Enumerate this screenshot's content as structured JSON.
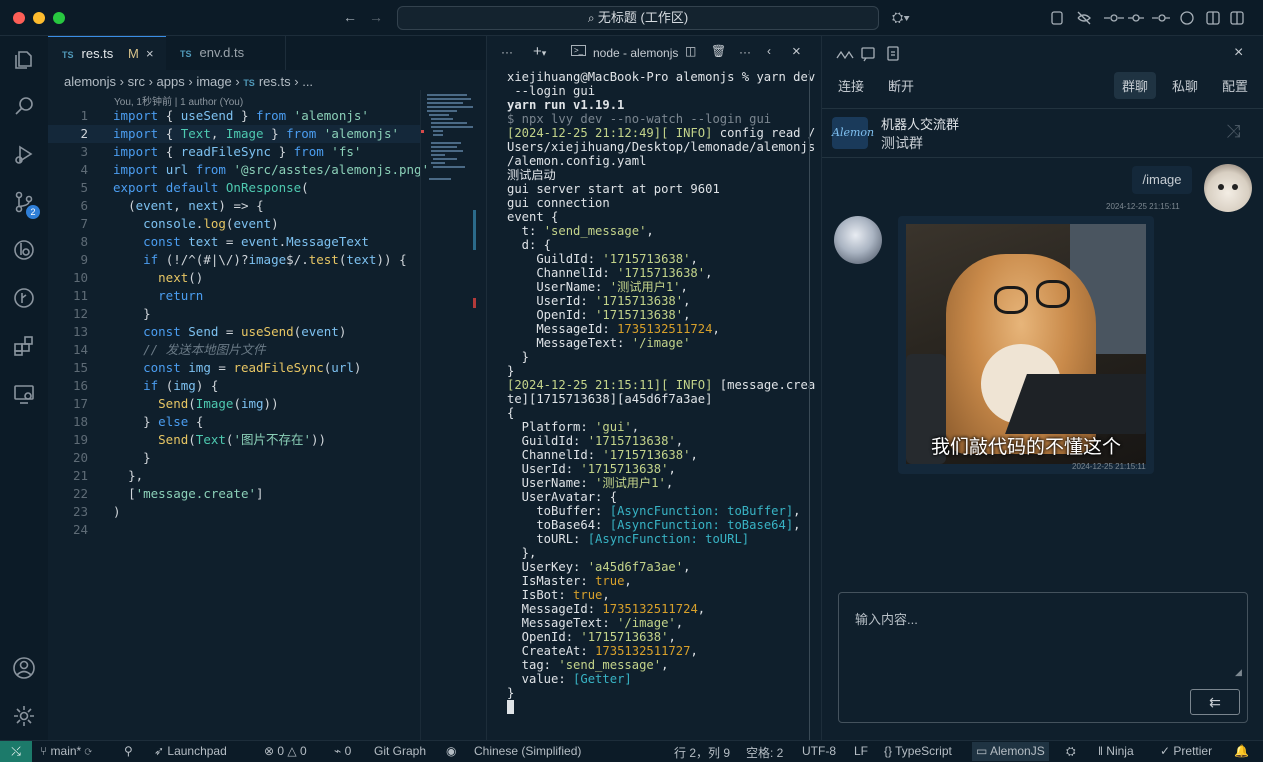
{
  "titlebar": {
    "search_label": "无标题 (工作区)"
  },
  "tabs": [
    {
      "badge": "TS",
      "label": "res.ts",
      "status": "M"
    },
    {
      "badge": "TS",
      "label": "env.d.ts"
    }
  ],
  "breadcrumb": {
    "items": [
      "alemonjs",
      "src",
      "apps",
      "image",
      "res.ts",
      "..."
    ],
    "file_badge": "TS"
  },
  "blame": "You, 1秒钟前 | 1 author (You)",
  "code": {
    "line_numbers": [
      "1",
      "2",
      "3",
      "4",
      "5",
      "6",
      "7",
      "8",
      "9",
      "10",
      "11",
      "12",
      "13",
      "14",
      "15",
      "16",
      "17",
      "18",
      "19",
      "20",
      "21",
      "22",
      "23",
      "24"
    ],
    "lines": [
      "import { useSend } from 'alemonjs'",
      "import { Text, Image } from 'alemonjs'",
      "import { readFileSync } from 'fs'",
      "import url from '@src/asstes/alemonjs.png'",
      "export default OnResponse(",
      "  (event, next) => {",
      "    console.log(event)",
      "    const text = event.MessageText",
      "    if (!/^(#|\\/)?image$/.test(text)) {",
      "      next()",
      "      return",
      "    }",
      "    const Send = useSend(event)",
      "    // 发送本地图片文件",
      "    const img = readFileSync(url)",
      "    if (img) {",
      "      Send(Image(img))",
      "    } else {",
      "      Send(Text('图片不存在'))",
      "    }",
      "  },",
      "  ['message.create']",
      ")",
      ""
    ]
  },
  "terminal": {
    "title": "node - alemonjs",
    "lines": [
      "xiejihuang@MacBook-Pro alemonjs % yarn dev",
      " --login gui",
      "yarn run v1.19.1",
      "$ npx lvy dev --no-watch --login gui",
      "[2024-12-25 21:12:49][ INFO] config read /",
      "Users/xiejihuang/Desktop/lemonade/alemonjs",
      "/alemon.config.yaml",
      "测试启动",
      "gui server start at port 9601",
      "gui connection",
      "event {",
      "  t: 'send_message',",
      "  d: {",
      "    GuildId: '1715713638',",
      "    ChannelId: '1715713638',",
      "    UserName: '测试用户1',",
      "    UserId: '1715713638',",
      "    OpenId: '1715713638',",
      "    MessageId: 1735132511724,",
      "    MessageText: '/image'",
      "  }",
      "}",
      "[2024-12-25 21:15:11][ INFO] [message.crea",
      "te][1715713638][a45d6f7a3ae]",
      "{",
      "  Platform: 'gui',",
      "  GuildId: '1715713638',",
      "  ChannelId: '1715713638',",
      "  UserId: '1715713638',",
      "  UserName: '测试用户1',",
      "  UserAvatar: {",
      "    toBuffer: [AsyncFunction: toBuffer],",
      "    toBase64: [AsyncFunction: toBase64],",
      "    toURL: [AsyncFunction: toURL]",
      "  },",
      "  UserKey: 'a45d6f7a3ae',",
      "  IsMaster: true,",
      "  IsBot: true,",
      "  MessageId: 1735132511724,",
      "  MessageText: '/image',",
      "  OpenId: '1715713638',",
      "  CreateAt: 1735132511727,",
      "  tag: 'send_message',",
      "  value: [Getter]",
      "}"
    ]
  },
  "chat": {
    "nav": {
      "connect": "连接",
      "disconnect": "断开",
      "group": "群聊",
      "private": "私聊",
      "config": "配置"
    },
    "group_name": "机器人交流群",
    "group_sub": "测试群",
    "logo_text": "Alemon",
    "messages": [
      {
        "text": "/image",
        "time": "2024-12-25 21:15:11"
      },
      {
        "image_caption": "我们敲代码的不懂这个",
        "time": "2024-12-25 21:15:11"
      }
    ],
    "input_placeholder": "输入内容...",
    "send_label": "⇇"
  },
  "statusbar": {
    "branch": "main*",
    "launchpad": "Launchpad",
    "errors": "0",
    "warnings": "0",
    "ports": "0",
    "gitgraph": "Git Graph",
    "language_pack": "Chinese (Simplified)",
    "position": "行 2，列 9",
    "spaces": "空格: 2",
    "encoding": "UTF-8",
    "eol": "LF",
    "language": "TypeScript",
    "alemon": "AlemonJS",
    "ninja": "Ninja",
    "prettier": "Prettier"
  }
}
